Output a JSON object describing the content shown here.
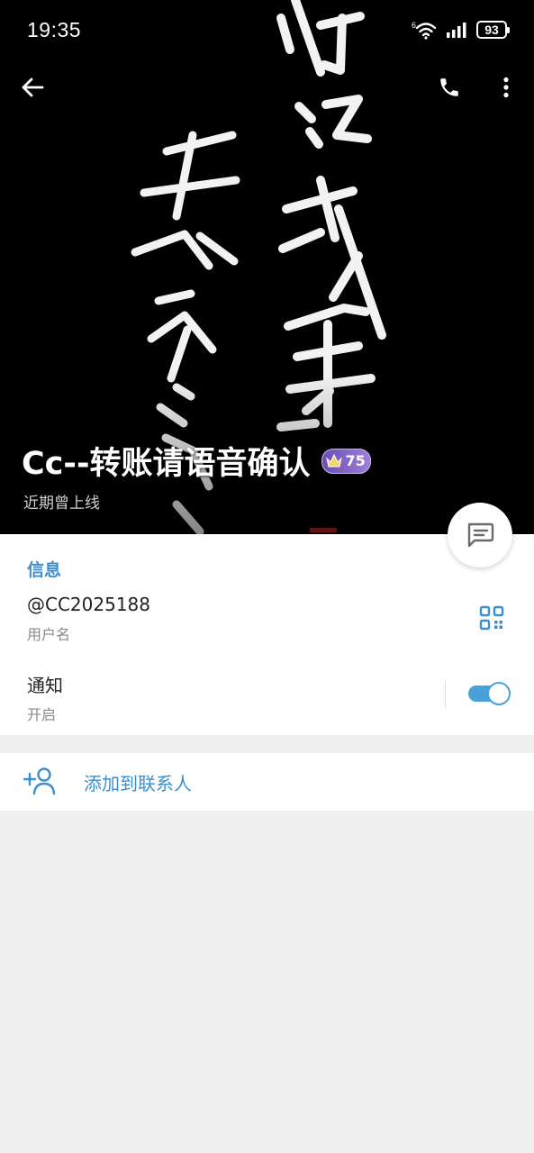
{
  "status_bar": {
    "time": "19:35",
    "network": "6",
    "battery": "93"
  },
  "profile": {
    "name": "Cc--转账请语音确认",
    "level": "75",
    "status": "近期曾上线"
  },
  "info": {
    "section_title": "信息",
    "username": "@CC2025188",
    "username_label": "用户名",
    "notifications": "通知",
    "notifications_state": "开启",
    "notifications_on": true
  },
  "actions": {
    "add_contact": "添加到联系人"
  },
  "colors": {
    "accent": "#3a8fd0",
    "toggle": "#4aa0d8",
    "background": "#efefef"
  },
  "icons": {
    "back": "arrow-left-icon",
    "call": "phone-icon",
    "menu": "more-vertical-icon",
    "message": "message-icon",
    "qr": "qr-code-icon",
    "add_contact": "add-person-icon"
  }
}
